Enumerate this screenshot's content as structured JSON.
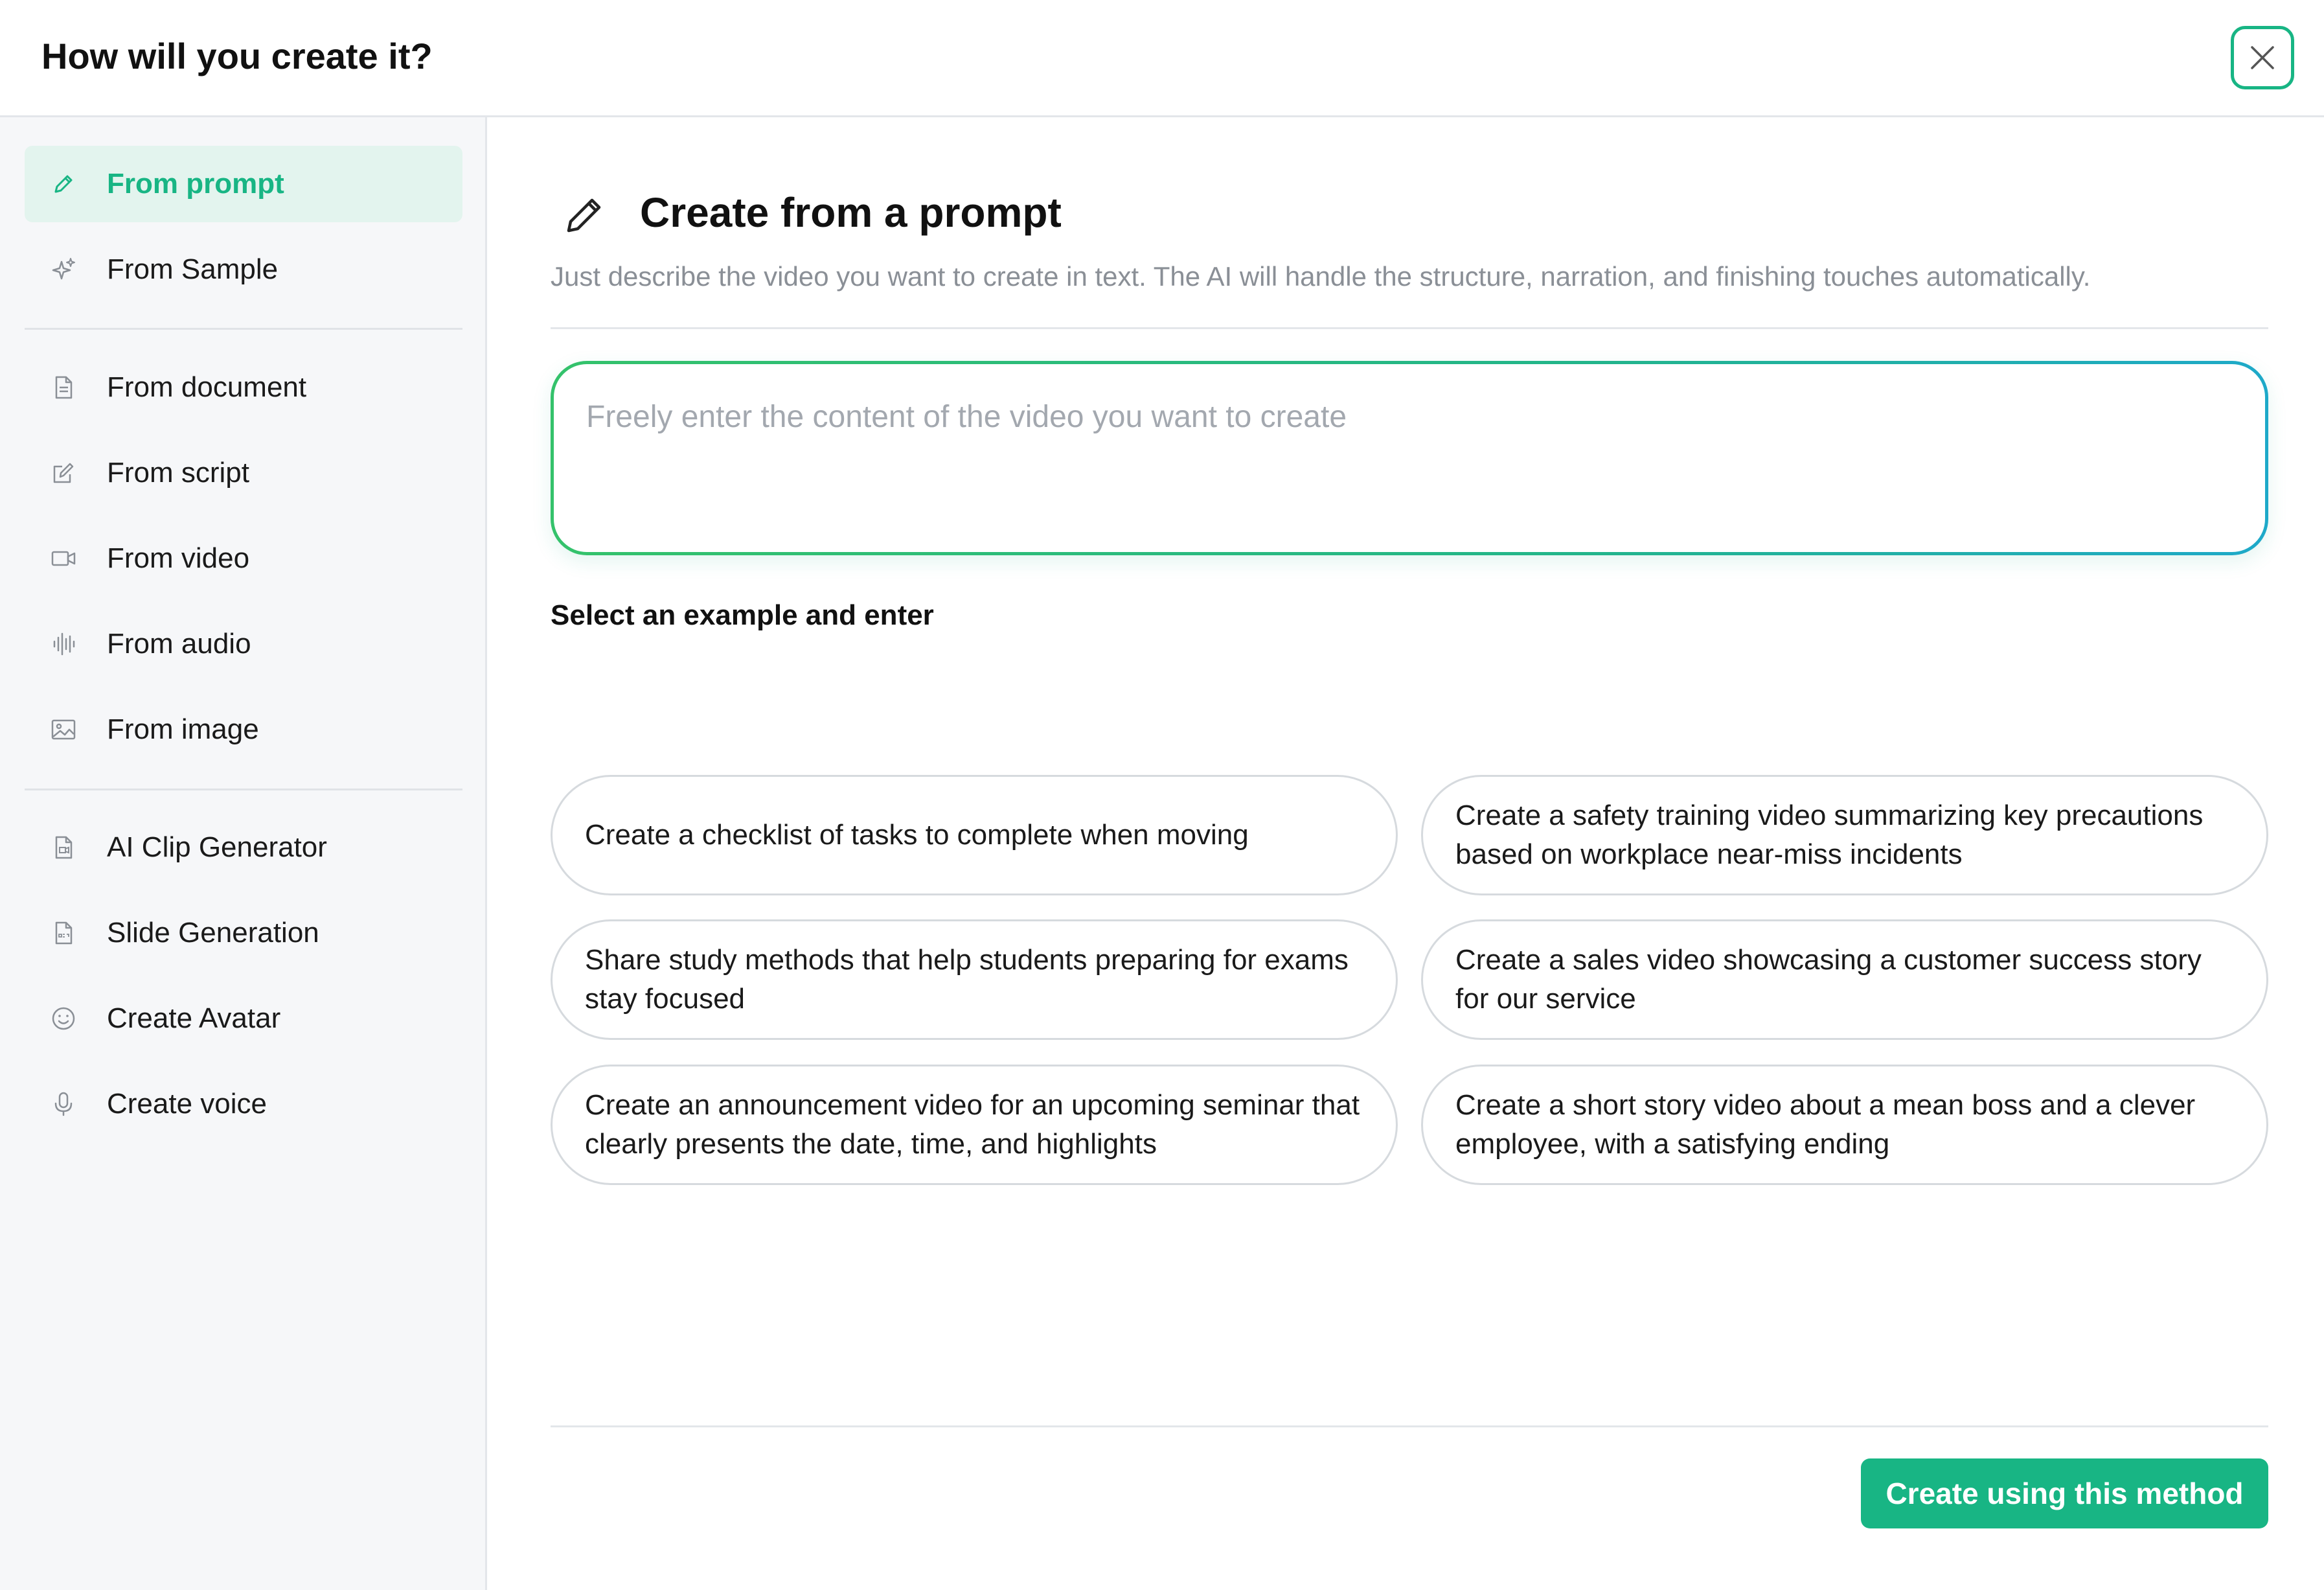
{
  "header": {
    "title": "How will you create it?",
    "close_icon": "close-icon"
  },
  "sidebar": {
    "items": [
      {
        "label": "From prompt",
        "icon": "pencil-icon",
        "active": true
      },
      {
        "label": "From Sample",
        "icon": "sparkle-icon"
      },
      {
        "label": "From document",
        "icon": "document-icon"
      },
      {
        "label": "From script",
        "icon": "edit-square-icon"
      },
      {
        "label": "From video",
        "icon": "video-camera-icon"
      },
      {
        "label": "From audio",
        "icon": "audio-wave-icon"
      },
      {
        "label": "From image",
        "icon": "image-icon"
      },
      {
        "label": "AI Clip Generator",
        "icon": "clip-file-icon"
      },
      {
        "label": "Slide Generation",
        "icon": "ppt-file-icon"
      },
      {
        "label": "Create Avatar",
        "icon": "smiley-icon"
      },
      {
        "label": "Create voice",
        "icon": "microphone-icon"
      }
    ]
  },
  "main": {
    "title": "Create from a prompt",
    "description": "Just describe the video you want to create in text. The AI will handle the structure, narration, and finishing touches automatically.",
    "prompt": {
      "placeholder": "Freely enter the content of the video you want to create",
      "value": ""
    },
    "examples_heading": "Select an example and enter",
    "examples": [
      "Create a checklist of tasks to complete when moving",
      "Create a safety training video summarizing key precautions based on workplace near-miss incidents",
      "Share study methods that help students preparing for exams stay focused",
      "Create a sales video showcasing a customer success story for our service",
      "Create an announcement video for an upcoming seminar that clearly presents the date, time, and highlights",
      "Create a short story video about a mean boss and a clever employee, with a satisfying ending"
    ],
    "primary_button": "Create using this method"
  },
  "colors": {
    "accent": "#18b584",
    "active_bg": "#e3f4ee",
    "sidebar_bg": "#f6f7f9",
    "muted_text": "#8a8f96"
  }
}
